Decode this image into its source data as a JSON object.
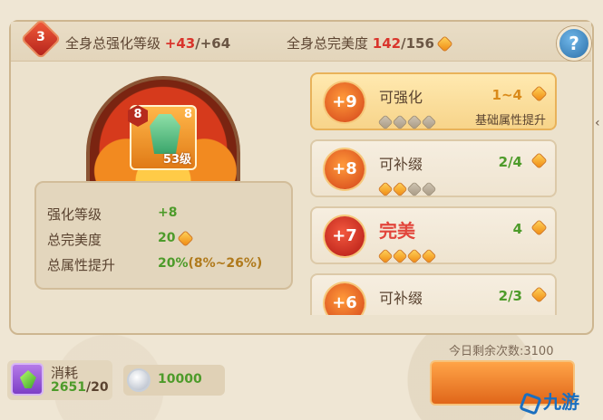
{
  "header": {
    "level_badge": "3",
    "strength_label": "全身总强化等级",
    "strength_current": "+43",
    "strength_max": "/+64",
    "perfect_label": "全身总完美度",
    "perfect_current": "142",
    "perfect_max": "/156",
    "help_label": "?"
  },
  "item": {
    "enhance_level": "8",
    "lock_label": "8",
    "item_level": "53级"
  },
  "stats": {
    "rows": [
      {
        "label": "强化等级",
        "value": "+8"
      },
      {
        "label": "总完美度",
        "value": "20"
      },
      {
        "label": "总属性提升",
        "value": "20%",
        "range": "(8%~26%)"
      }
    ]
  },
  "slots": [
    {
      "bonus": "+9",
      "name": "可强化",
      "progress": "1~4",
      "desc": "基础属性提升",
      "filled": 0,
      "total": 4,
      "selected": true
    },
    {
      "bonus": "+8",
      "name": "可补缀",
      "progress": "2/4",
      "desc": "",
      "filled": 3,
      "total": 4,
      "selected": false
    },
    {
      "bonus": "+7",
      "name": "完美",
      "progress": "4",
      "desc": "",
      "filled": 4,
      "total": 4,
      "selected": false
    },
    {
      "bonus": "+6",
      "name": "可补缀",
      "progress": "2/3",
      "desc": "",
      "filled": 3,
      "total": 4,
      "selected": false
    }
  ],
  "footer": {
    "remaining": "今日剩余次数:3100",
    "cost_label": "消耗",
    "cost_have": "2651",
    "cost_need": "/20",
    "silver": "10000"
  },
  "watermark": "九游",
  "colors": {
    "accent_orange": "#e0661a",
    "green_value": "#4d9b2a",
    "red_value": "#d9342b"
  }
}
